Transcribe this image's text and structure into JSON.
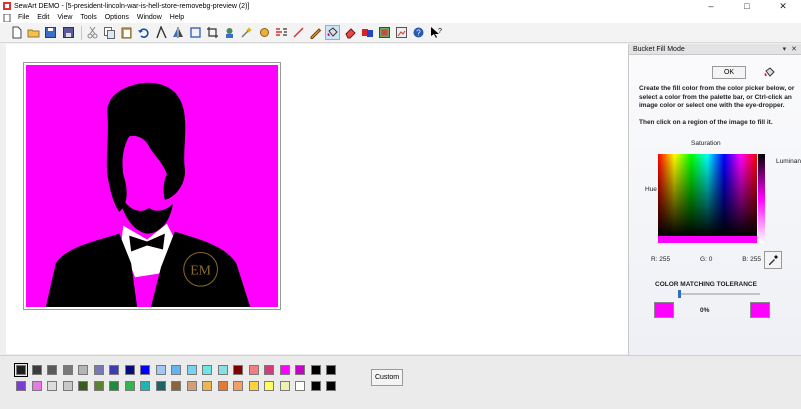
{
  "window": {
    "title": "SewArt DEMO - [5-president-lincoln-war-is-hell-store-removebg-preview (2)]",
    "minimize_icon": "minimize-icon",
    "maximize_icon": "maximize-icon",
    "close_icon": "close-icon"
  },
  "menu": {
    "items": [
      "File",
      "Edit",
      "View",
      "Tools",
      "Options",
      "Window",
      "Help"
    ]
  },
  "toolbar": {
    "icons": [
      "new-file-icon",
      "open-folder-icon",
      "save-icon",
      "save-as-icon",
      "cut-icon",
      "copy-icon",
      "paste-icon",
      "undo-icon",
      "redo-icon",
      "mirror-icon",
      "rotate-icon",
      "resize-icon",
      "crop-icon",
      "magic-wand-icon",
      "merge-icon",
      "line-icon",
      "stitch-icon",
      "pencil-icon",
      "bucket-fill-icon",
      "eraser-icon",
      "color-reduce-icon",
      "sew-icon",
      "export-icon",
      "help-icon",
      "context-help-icon"
    ],
    "active": "bucket-fill-icon"
  },
  "panel": {
    "title": "Bucket Fill Mode",
    "ok_label": "OK",
    "instructions_1": "Create the fill color from the color picker below, or select a color from the palette bar, or Ctrl-click an image color or select one with the eye-dropper.",
    "instructions_2": "Then click on a region of the image to fill it.",
    "saturation_label": "Saturation",
    "hue_label": "Hue",
    "luminance_label": "Luminance",
    "r_value": "R: 255",
    "g_value": "G: 0",
    "b_value": "B: 255",
    "tolerance_label": "COLOR MATCHING TOLERANCE",
    "tolerance_value": "0%",
    "tolerance_level": 0.0,
    "fill_color": "#ff00ff"
  },
  "canvas": {
    "background_color": "#ff00ff",
    "image_subject": "portrait-silhouette",
    "watermark_text": "EM"
  },
  "palette": {
    "custom_label": "Custom",
    "selected_index": 0,
    "colors": [
      "#1e1e1e",
      "#3c3c3c",
      "#5a5a5a",
      "#787878",
      "#b4b4b4",
      "#7878b4",
      "#3c3cb4",
      "#0a0a80",
      "#0000ff",
      "#a0c8f0",
      "#64b4f0",
      "#78d2f0",
      "#6ee6e6",
      "#8ae0e0",
      "#800000",
      "#f08080",
      "#d23c78",
      "#ff00ff",
      "#c800c8",
      "#000000",
      "#000000",
      "#7a3cd2",
      "#e678e6",
      "#dcdcdc",
      "#c8c8c8",
      "#3c5a1e",
      "#5a8232",
      "#1e8c3c",
      "#32b450",
      "#1eb4b4",
      "#1e6464",
      "#8c643c",
      "#d2a078",
      "#f0b450",
      "#e67832",
      "#f0a064",
      "#ffd23c",
      "#ffff64",
      "#f0f0b4",
      "#ffffff",
      "#000000",
      "#000000"
    ]
  }
}
